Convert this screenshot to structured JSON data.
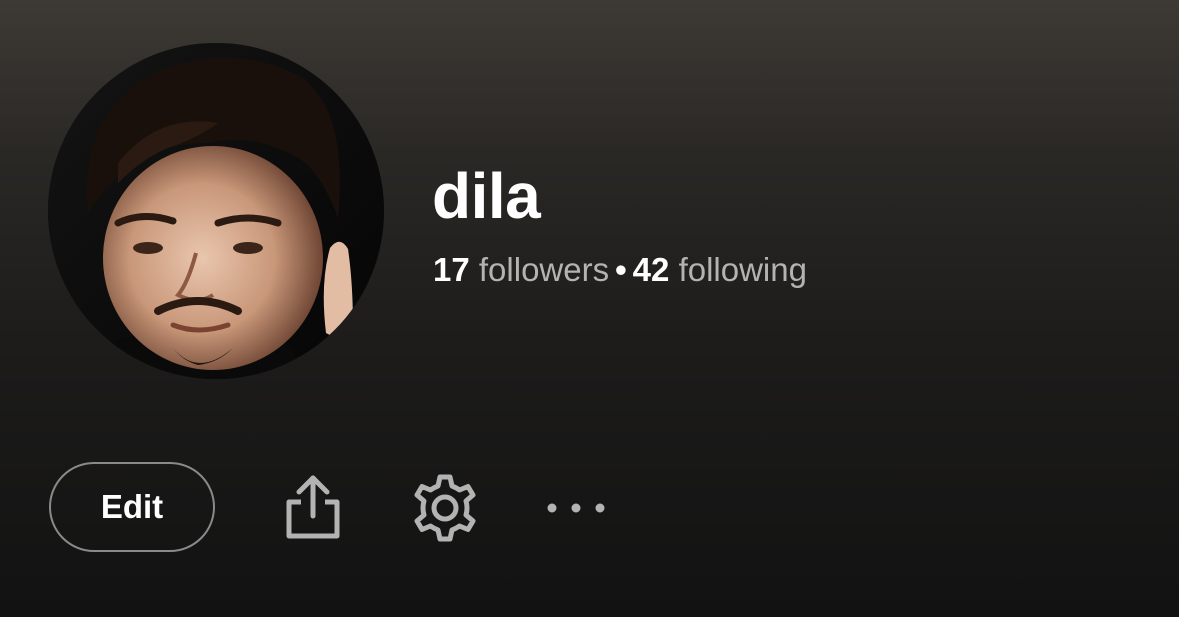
{
  "profile": {
    "username": "dila",
    "followers_count": "17",
    "followers_label": "followers",
    "separator": "•",
    "following_count": "42",
    "following_label": "following"
  },
  "actions": {
    "edit_label": "Edit",
    "share_icon": "share-icon",
    "settings_icon": "gear-icon",
    "more_icon": "more-horizontal-icon"
  },
  "colors": {
    "text_primary": "#ffffff",
    "text_secondary": "#b3b3b3",
    "button_border": "#8a8a8a",
    "icon_gray": "#b3b3b3"
  }
}
